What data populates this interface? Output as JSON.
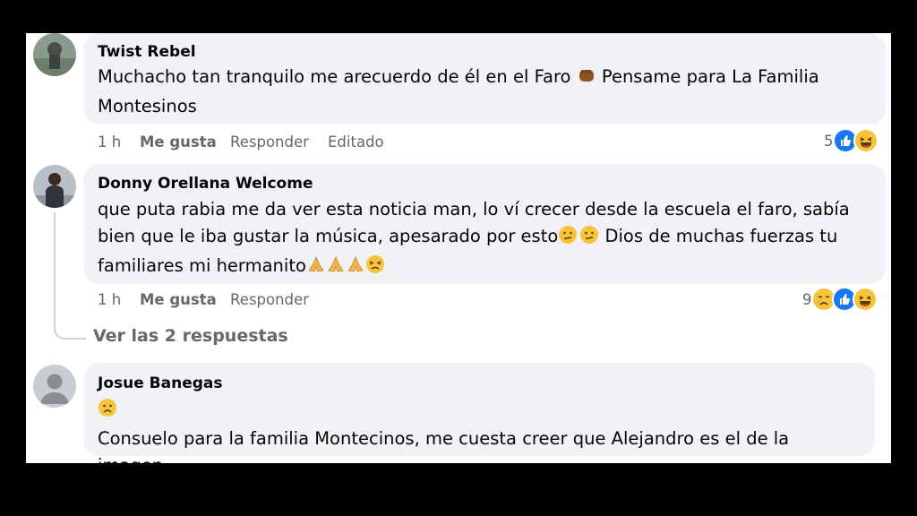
{
  "comments": [
    {
      "author": "Twist Rebel",
      "text_line1": "Muchacho tan tranquilo me arecuerdo de él en el Faro",
      "text_line1b": "Pensame para La Familia",
      "text_line2": "Montesinos",
      "time": "1 h",
      "like": "Me gusta",
      "reply": "Responder",
      "edited": "Editado",
      "reaction_count": "5",
      "reactions": [
        "like-reaction",
        "laugh-reaction"
      ]
    },
    {
      "author": "Donny Orellana Welcome",
      "text_line1": "que puta rabia me da ver esta noticia man, lo ví crecer desde la escuela el faro, sabía",
      "text_line2a": "bien que le iba gustar la música, apesarado por esto",
      "text_line2b": "Dios de muchas fuerzas tu",
      "text_line3": "familiares mi hermanito",
      "time": "1 h",
      "like": "Me gusta",
      "reply": "Responder",
      "reaction_count": "9",
      "reactions": [
        "sad-reaction",
        "like-reaction",
        "laugh-reaction"
      ],
      "view_replies": "Ver las 2 respuestas"
    },
    {
      "author": "Josue Banegas",
      "text_line2": "Consuelo para la familia Montecinos, me cuesta creer que Alejandro es el de la imagen."
    }
  ],
  "colors": {
    "like_blue": "#1877f2",
    "bubble": "#f0f2f5",
    "meta": "#65676b",
    "emoji_yellow": "#f7c33b"
  }
}
